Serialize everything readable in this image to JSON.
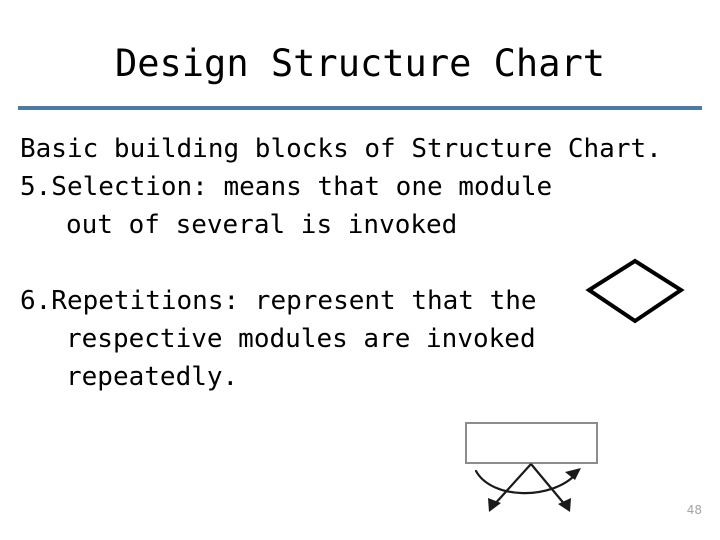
{
  "slide": {
    "title": "Design Structure Chart",
    "page_number": "48",
    "divider_color": "#4a7ba6",
    "background_color": "#ffffff",
    "text_color": "#000000"
  },
  "body": {
    "intro": {
      "line1": "Basic building blocks of Structure",
      "line2": "Chart."
    },
    "items": [
      {
        "number": "5.",
        "term": "Selection:",
        "line1": "5.Selection: means that one module",
        "line2": "out of several is invoked"
      },
      {
        "number": "6.",
        "term": "Repetitions:",
        "line1": "6.Repetitions: represent that the",
        "line2": "respective modules are invoked",
        "line3": "repeatedly."
      }
    ]
  },
  "shapes": {
    "selection_symbol": {
      "name": "diamond",
      "stroke_color": "#000000",
      "fill_color": "#ffffff",
      "stroke_width": "3"
    },
    "repetition_symbol": {
      "name": "module-box-with-loop-arrows",
      "box_stroke_color": "#808080",
      "box_fill_color": "#ffffff",
      "arrow_color": "#1a1a1a",
      "stroke_width": "2"
    }
  }
}
